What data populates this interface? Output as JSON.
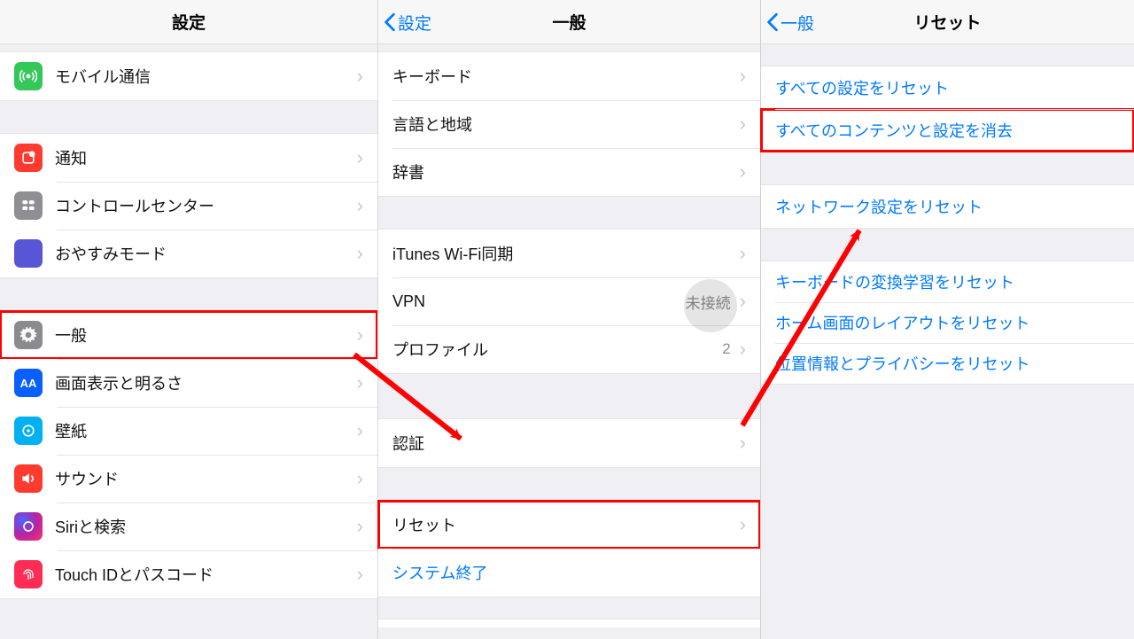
{
  "panel1": {
    "title": "設定",
    "rows": {
      "mobile": "モバイル通信",
      "notifications": "通知",
      "controlcenter": "コントロールセンター",
      "dnd": "おやすみモード",
      "general": "一般",
      "display": "画面表示と明るさ",
      "wallpaper": "壁紙",
      "sound": "サウンド",
      "siri": "Siriと検索",
      "touchid": "Touch IDとパスコード"
    }
  },
  "panel2": {
    "back": "設定",
    "title": "一般",
    "rows": {
      "keyboard": "キーボード",
      "language": "言語と地域",
      "dictionary": "辞書",
      "itunes": "iTunes Wi-Fi同期",
      "vpn": "VPN",
      "vpn_status": "未接続",
      "profile": "プロファイル",
      "profile_count": "2",
      "auth": "認証",
      "reset": "リセット",
      "shutdown": "システム終了"
    }
  },
  "panel3": {
    "back": "一般",
    "title": "リセット",
    "rows": {
      "reset_all": "すべての設定をリセット",
      "erase_all": "すべてのコンテンツと設定を消去",
      "reset_network": "ネットワーク設定をリセット",
      "reset_keyboard": "キーボードの変換学習をリセット",
      "reset_home": "ホーム画面のレイアウトをリセット",
      "reset_location": "位置情報とプライバシーをリセット"
    }
  }
}
